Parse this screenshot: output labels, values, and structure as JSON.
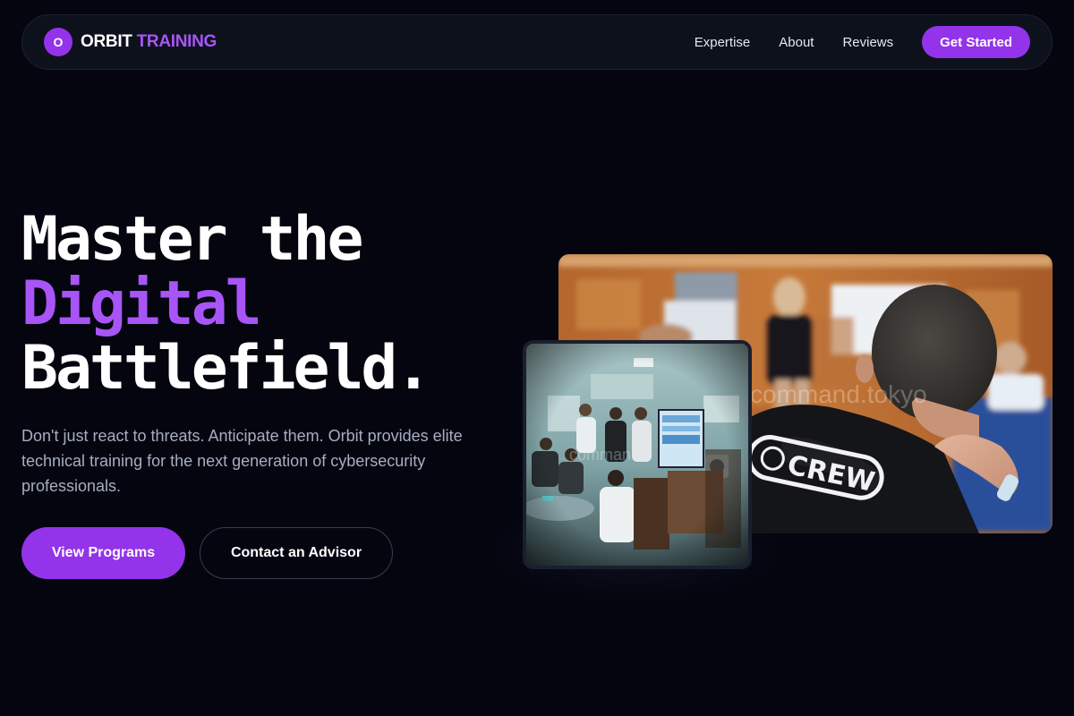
{
  "brand": {
    "logo_letter": "O",
    "name_primary": "ORBIT",
    "name_accent": "TRAINING"
  },
  "nav": {
    "links": [
      "Expertise",
      "About",
      "Reviews"
    ],
    "cta_label": "Get Started"
  },
  "hero": {
    "title_line1": "Master the",
    "title_line2": "Digital",
    "title_line3": "Battlefield.",
    "description": "Don't just react to threats. Anticipate them. Orbit provides elite technical training for the next generation of cybersecurity professionals.",
    "primary_button": "View Programs",
    "secondary_button": "Contact an Advisor"
  },
  "images": {
    "main": {
      "shirt_text": "CREW",
      "watermark": "command.tokyo"
    },
    "small": {
      "watermark": "comman"
    }
  },
  "colors": {
    "background": "#04050f",
    "accent": "#9333ea",
    "accent_text": "#a855f7",
    "nav_bg": "#0d111c",
    "muted_text": "#a6aec2"
  }
}
